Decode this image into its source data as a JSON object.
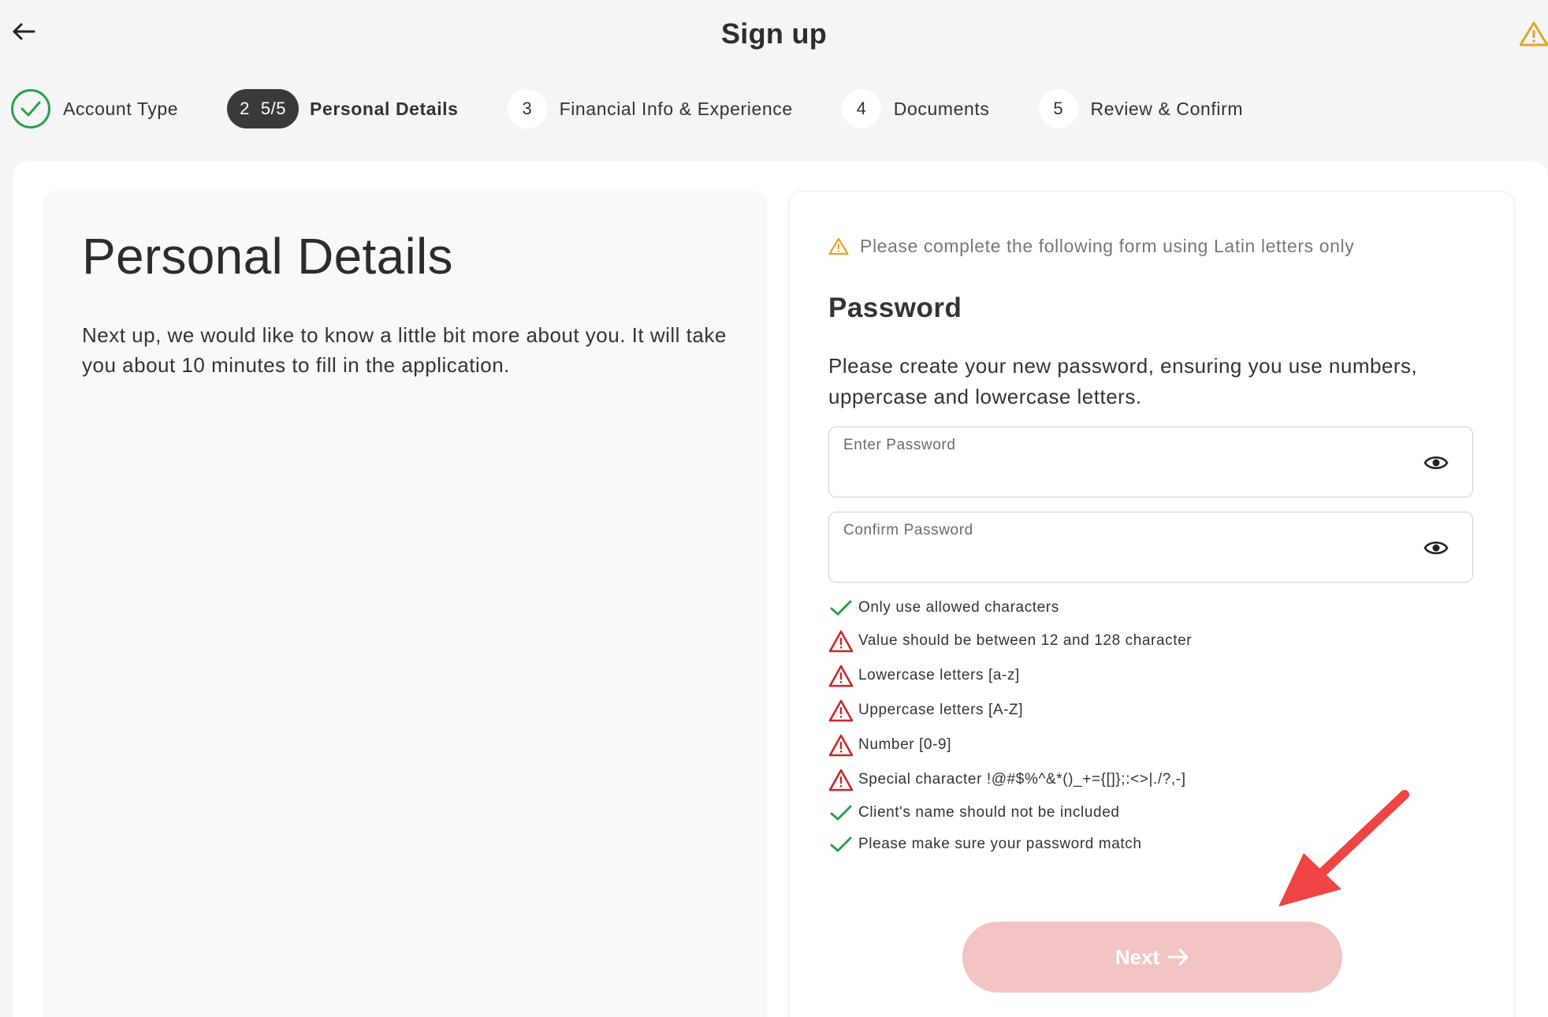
{
  "header": {
    "title": "Sign up"
  },
  "stepper": {
    "steps": [
      {
        "label": "Account Type",
        "status": "complete"
      },
      {
        "number": "2",
        "progress": "5/5",
        "label": "Personal Details",
        "status": "active"
      },
      {
        "number": "3",
        "label": "Financial Info & Experience",
        "status": "pending"
      },
      {
        "number": "4",
        "label": "Documents",
        "status": "pending"
      },
      {
        "number": "5",
        "label": "Review & Confirm",
        "status": "pending"
      }
    ]
  },
  "intro": {
    "title": "Personal Details",
    "description": "Next up, we would like to know a little bit more about you. It will take you about 10 minutes to fill in the application."
  },
  "form": {
    "notice": "Please complete the following form using Latin letters only",
    "section_title": "Password",
    "section_description": "Please create your new password, ensuring you use numbers, uppercase and lowercase letters.",
    "password": {
      "label": "Enter Password",
      "value": ""
    },
    "confirm_password": {
      "label": "Confirm Password",
      "value": ""
    },
    "rules": [
      {
        "text": "Only use allowed characters",
        "status": "passed"
      },
      {
        "text": "Value should be between 12 and 128 character",
        "status": "failed"
      },
      {
        "text": "Lowercase letters [a-z]",
        "status": "failed"
      },
      {
        "text": "Uppercase letters [A-Z]",
        "status": "failed"
      },
      {
        "text": "Number [0-9]",
        "status": "failed"
      },
      {
        "text": "Special character !@#$%^&*()_+={[]};:<>|./?,-]",
        "status": "failed"
      },
      {
        "text": "Client's name should not be included",
        "status": "passed"
      },
      {
        "text": "Please make sure your password match",
        "status": "passed"
      }
    ],
    "next_label": "Next",
    "next_disabled": true
  },
  "colors": {
    "success": "#27a24a",
    "error": "#c62828",
    "warning": "#e0a526",
    "active_step": "#3a3a3a",
    "next_disabled_bg": "#f2c4c4",
    "annotation_arrow": "#ef4444"
  },
  "icons": {
    "back": "arrow-left-icon",
    "header_alert": "warning-triangle-icon",
    "step_complete": "check-circle-icon",
    "password_visibility": "eye-icon",
    "rule_passed": "check-icon",
    "rule_failed": "error-triangle-icon",
    "next": "arrow-right-icon"
  }
}
